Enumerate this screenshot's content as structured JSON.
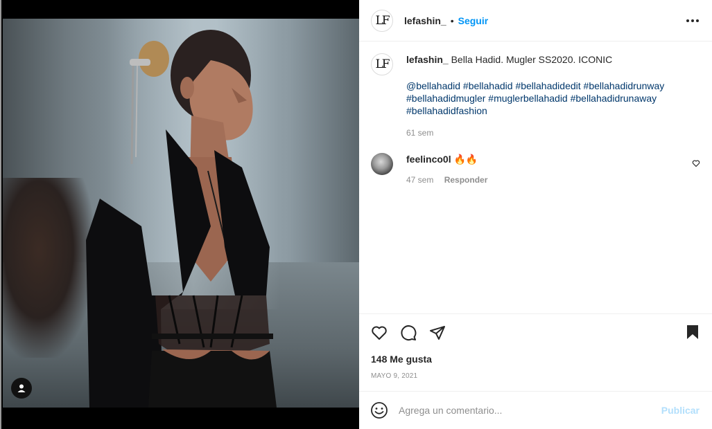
{
  "post": {
    "author": "lefashin_",
    "author_logo": "LF",
    "follow_dot": "•",
    "follow_label": "Seguir",
    "more_icon": "more-horizontal-icon"
  },
  "caption": {
    "user": "lefashin_",
    "text": "Bella Hadid. Mugler SS2020. ICONIC",
    "hashtags_line1": "@bellahadid #bellahadid #bellahadidedit #bellahadidrunway",
    "hashtags_line2": "#bellahadidmugler #muglerbellahadid #bellahadidrunaway",
    "hashtags_line3": "#bellahadidfashion",
    "time": "61 sem"
  },
  "comment": {
    "user": "feelinco0l",
    "text": "🔥🔥",
    "time": "47 sem",
    "reply_label": "Responder"
  },
  "actions": {
    "likes": "148 Me gusta",
    "date": "MAYO 9, 2021",
    "icons": [
      "heart-icon",
      "comment-icon",
      "share-icon",
      "bookmark-icon"
    ]
  },
  "add_comment": {
    "placeholder": "Agrega un comentario...",
    "publish_label": "Publicar"
  },
  "colors": {
    "link_blue": "#0095f6",
    "hashtag_blue": "#00376b",
    "muted": "#8e8e8e",
    "publish_disabled": "#b2dffc"
  }
}
